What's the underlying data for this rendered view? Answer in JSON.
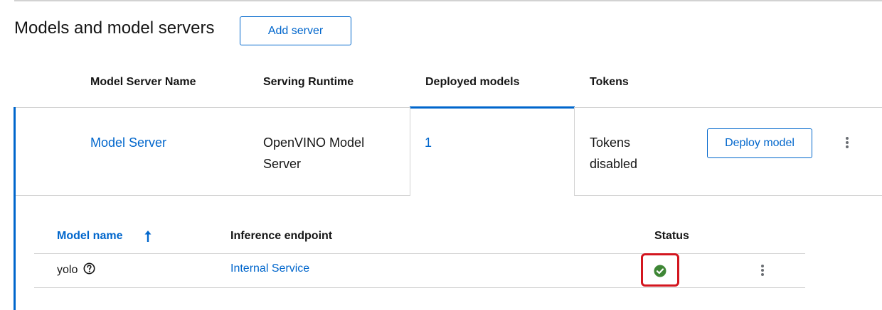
{
  "section": {
    "title": "Models and model servers",
    "add_server_label": "Add server"
  },
  "table": {
    "headers": [
      "Model Server Name",
      "Serving Runtime",
      "Deployed models",
      "Tokens"
    ],
    "active_tab": "Deployed models",
    "row": {
      "server_name": "Model Server",
      "runtime_line1": "OpenVINO Model",
      "runtime_line2": "Server",
      "deployed_count": "1",
      "tokens_line1": "Tokens",
      "tokens_line2": "disabled",
      "deploy_label": "Deploy model"
    }
  },
  "models_table": {
    "headers": {
      "name": "Model name",
      "endpoint": "Inference endpoint",
      "status": "Status"
    },
    "sort_column": "Model name",
    "sort_direction": "ascending",
    "rows": [
      {
        "name": "yolo",
        "endpoint": "Internal Service",
        "status": "ready"
      }
    ]
  },
  "colors": {
    "link": "#0066cc",
    "success": "#3e8635",
    "highlight": "#d3161f"
  },
  "icons": [
    "help-circle-icon",
    "success-check-icon",
    "kebab-menu-icon",
    "sort-asc-arrow-icon"
  ]
}
